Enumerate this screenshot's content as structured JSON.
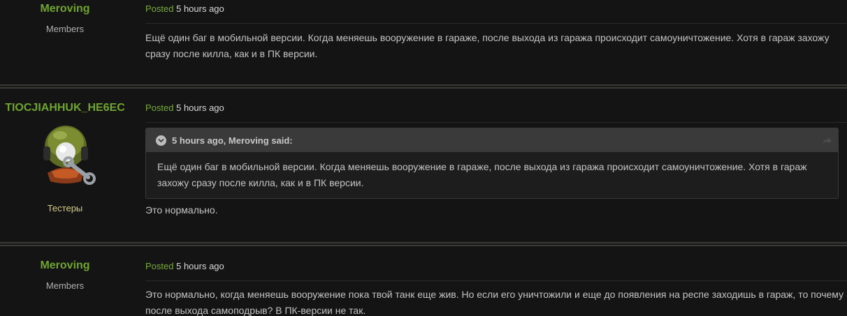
{
  "posts": [
    {
      "author": "Meroving",
      "group": "Members",
      "posted_label": "Posted",
      "time": "5 hours ago",
      "text": "Ещё один баг в мобильной версии. Когда меняешь вооружение в гараже, после выхода из гаража происходит самоуничтожение. Хотя в гараж захожу сразу после килла, как и в ПК версии."
    },
    {
      "author": "TIOCJIAHHUK_HE6EC",
      "group": "Тестеры",
      "posted_label": "Posted",
      "time": "5 hours ago",
      "quote_cite": "5 hours ago, Meroving said:",
      "quote_text": "Ещё один баг в мобильной версии. Когда меняешь вооружение в гараже, после выхода из гаража происходит самоуничтожение. Хотя в гараж захожу сразу после килла, как и в ПК версии.",
      "text": "Это нормально."
    },
    {
      "author": "Meroving",
      "group": "Members",
      "posted_label": "Posted",
      "time": "5 hours ago",
      "text": "Это нормально, когда меняешь вооружение пока твой танк еще жив. Но если его уничтожили и еще до появления на респе заходишь в гараж, то почему после выхода самоподрыв? В ПК-версии не так."
    }
  ],
  "colors": {
    "author_name": "#6fa52f",
    "posted_label": "#78ad3c",
    "quote_header_bg": "#3a3a3a",
    "background": "#141414"
  },
  "icons": {
    "quote_toggle": "chevron-down-icon",
    "quote_share": "share-arrow-icon",
    "avatar": "tester-avatar"
  }
}
